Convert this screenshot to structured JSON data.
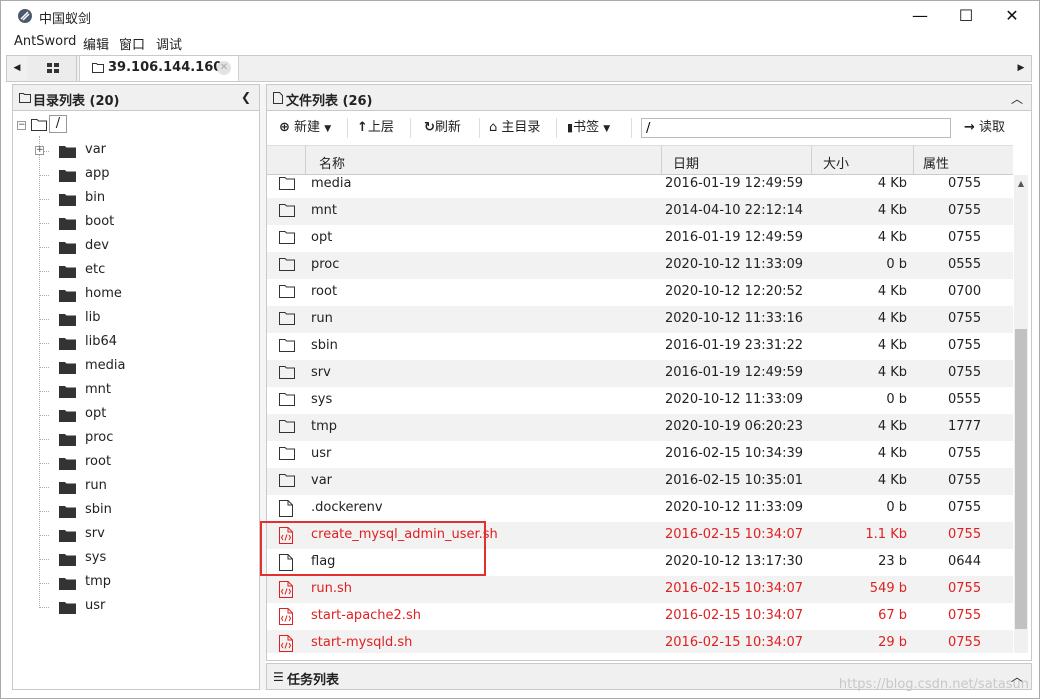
{
  "window": {
    "title": "中国蚁剑",
    "minimize": "—",
    "maximize": "☐",
    "close": "✕"
  },
  "menu": [
    "AntSword",
    "编辑",
    "窗口",
    "调试"
  ],
  "tabs": {
    "host": "39.106.144.160"
  },
  "dir_panel": {
    "title": "目录列表 (20)",
    "root": "/",
    "items": [
      "var",
      "app",
      "bin",
      "boot",
      "dev",
      "etc",
      "home",
      "lib",
      "lib64",
      "media",
      "mnt",
      "opt",
      "proc",
      "root",
      "run",
      "sbin",
      "srv",
      "sys",
      "tmp",
      "usr"
    ]
  },
  "file_panel": {
    "title": "文件列表 (26)",
    "toolbar": {
      "new": "新建",
      "up": "上层",
      "refresh": "刷新",
      "home": "主目录",
      "bookmark": "书签",
      "path": "/",
      "read": "读取"
    },
    "columns": [
      "名称",
      "日期",
      "大小",
      "属性"
    ],
    "rows": [
      {
        "name": "media",
        "date": "2016-01-19 12:49:59",
        "size": "4 Kb",
        "attr": "0755",
        "type": "folder"
      },
      {
        "name": "mnt",
        "date": "2014-04-10 22:12:14",
        "size": "4 Kb",
        "attr": "0755",
        "type": "folder"
      },
      {
        "name": "opt",
        "date": "2016-01-19 12:49:59",
        "size": "4 Kb",
        "attr": "0755",
        "type": "folder"
      },
      {
        "name": "proc",
        "date": "2020-10-12 11:33:09",
        "size": "0 b",
        "attr": "0555",
        "type": "folder"
      },
      {
        "name": "root",
        "date": "2020-10-12 12:20:52",
        "size": "4 Kb",
        "attr": "0700",
        "type": "folder"
      },
      {
        "name": "run",
        "date": "2020-10-12 11:33:16",
        "size": "4 Kb",
        "attr": "0755",
        "type": "folder"
      },
      {
        "name": "sbin",
        "date": "2016-01-19 23:31:22",
        "size": "4 Kb",
        "attr": "0755",
        "type": "folder"
      },
      {
        "name": "srv",
        "date": "2016-01-19 12:49:59",
        "size": "4 Kb",
        "attr": "0755",
        "type": "folder"
      },
      {
        "name": "sys",
        "date": "2020-10-12 11:33:09",
        "size": "0 b",
        "attr": "0555",
        "type": "folder"
      },
      {
        "name": "tmp",
        "date": "2020-10-19 06:20:23",
        "size": "4 Kb",
        "attr": "1777",
        "type": "folder"
      },
      {
        "name": "usr",
        "date": "2016-02-15 10:34:39",
        "size": "4 Kb",
        "attr": "0755",
        "type": "folder"
      },
      {
        "name": "var",
        "date": "2016-02-15 10:35:01",
        "size": "4 Kb",
        "attr": "0755",
        "type": "folder"
      },
      {
        "name": ".dockerenv",
        "date": "2020-10-12 11:33:09",
        "size": "0 b",
        "attr": "0755",
        "type": "file"
      },
      {
        "name": "create_mysql_admin_user.sh",
        "date": "2016-02-15 10:34:07",
        "size": "1.1 Kb",
        "attr": "0755",
        "type": "script"
      },
      {
        "name": "flag",
        "date": "2020-10-12 13:17:30",
        "size": "23 b",
        "attr": "0644",
        "type": "file"
      },
      {
        "name": "run.sh",
        "date": "2016-02-15 10:34:07",
        "size": "549 b",
        "attr": "0755",
        "type": "script"
      },
      {
        "name": "start-apache2.sh",
        "date": "2016-02-15 10:34:07",
        "size": "67 b",
        "attr": "0755",
        "type": "script"
      },
      {
        "name": "start-mysqld.sh",
        "date": "2016-02-15 10:34:07",
        "size": "29 b",
        "attr": "0755",
        "type": "script"
      }
    ]
  },
  "task_panel": {
    "title": "任务列表"
  },
  "watermark": "https://blog.csdn.net/satasun",
  "colors": {
    "script_text": "#e02020",
    "highlight_box": "#e03030"
  }
}
